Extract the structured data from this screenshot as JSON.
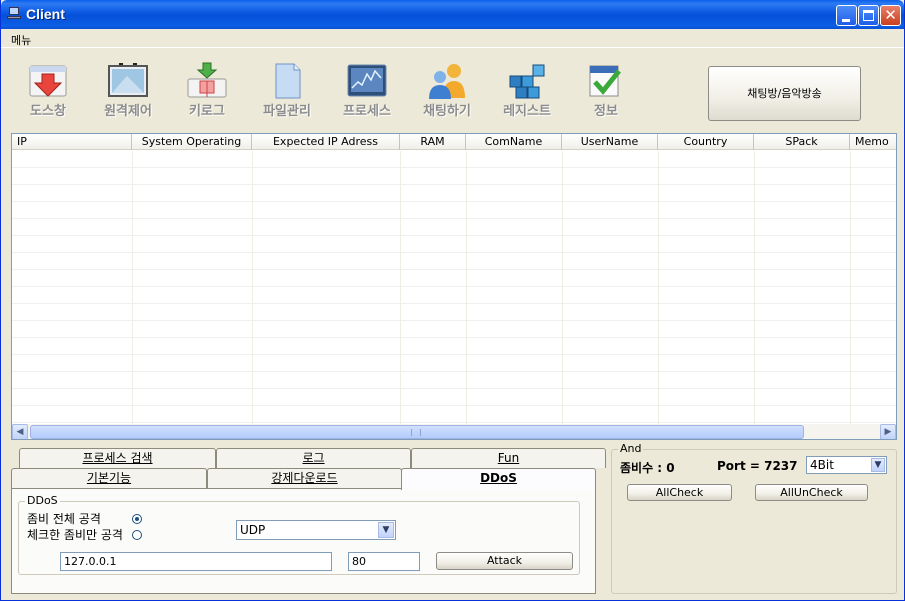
{
  "window": {
    "title": "Client"
  },
  "menu": {
    "items": [
      "메뉴"
    ]
  },
  "toolbar": {
    "items": [
      {
        "label": "도스창",
        "icon": "download-box-icon"
      },
      {
        "label": "원격제어",
        "icon": "monitor-icon"
      },
      {
        "label": "키로그",
        "icon": "keyboard-arrow-icon"
      },
      {
        "label": "파일관리",
        "icon": "file-icon"
      },
      {
        "label": "프로세스",
        "icon": "chart-monitor-icon"
      },
      {
        "label": "채팅하기",
        "icon": "users-chat-icon"
      },
      {
        "label": "레지스트",
        "icon": "registry-cubes-icon"
      },
      {
        "label": "정보",
        "icon": "calendar-check-icon"
      }
    ],
    "chat_music_button": "채팅방/음악방송"
  },
  "table": {
    "columns": [
      "IP",
      "System Operating",
      "Expected IP Adress",
      "RAM",
      "ComName",
      "UserName",
      "Country",
      "SPack",
      "Memo"
    ]
  },
  "tabs": {
    "row1": [
      "프로세스 검색",
      "로그",
      "Fun"
    ],
    "row2": [
      "기본기능",
      "강제다운로드",
      "DDoS"
    ],
    "active": "DDoS"
  },
  "ddos": {
    "group_title": "DDoS",
    "radio_all": "좀비 전체 공격",
    "radio_checked": "체크한 좀비만 공격",
    "protocol": "UDP",
    "target_ip": "127.0.0.1",
    "port": "80",
    "attack_button": "Attack"
  },
  "right_panel": {
    "group_title": "And",
    "zombie_label": "좀비수 : 0",
    "port_label": "Port = 7237",
    "bit_select": "4Bit",
    "all_check": "AllCheck",
    "all_uncheck": "AllUnCheck"
  },
  "colors": {
    "title_bar": "#0a57e0",
    "face": "#ece9d8",
    "border": "#7f9db9"
  }
}
